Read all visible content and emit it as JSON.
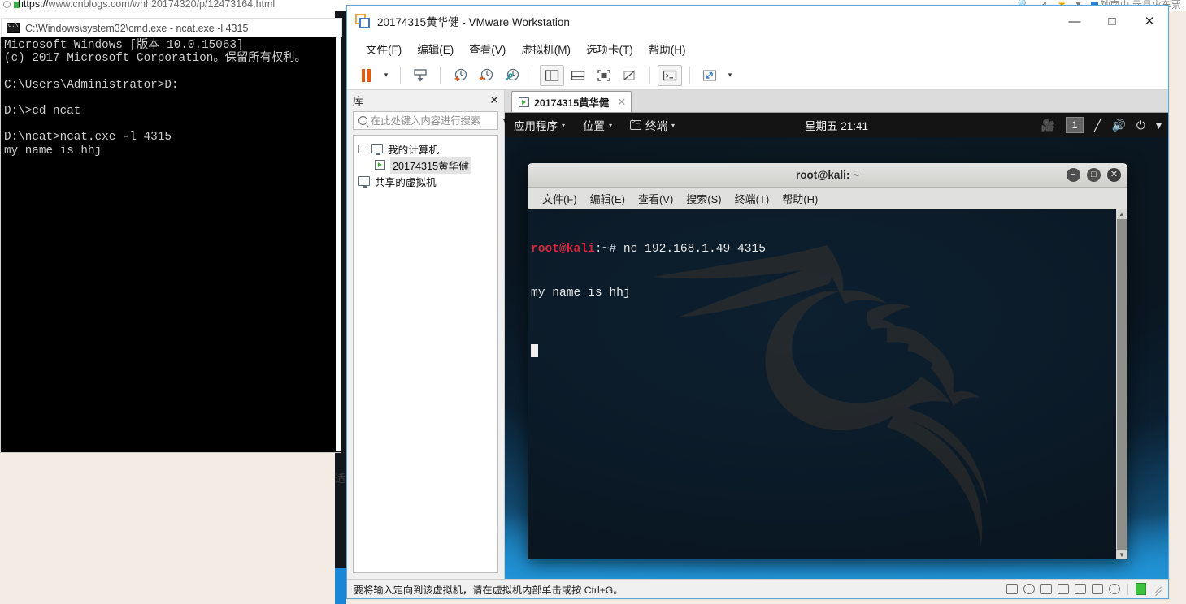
{
  "browser": {
    "url_protocol": "https://",
    "url": "www.cnblogs.com/whh20174320/p/12473164.html",
    "right_items": [
      "search-icon",
      "share-icon",
      "star-icon",
      "chevron-down-icon"
    ],
    "right_text": "钟南山 元旦火车票"
  },
  "cmd": {
    "title": "C:\\Windows\\system32\\cmd.exe - ncat.exe  -l 4315",
    "icon": "cmd-icon",
    "lines": [
      "Microsoft Windows [版本 10.0.15063]",
      "(c) 2017 Microsoft Corporation。保留所有权利。",
      "",
      "C:\\Users\\Administrator>D:",
      "",
      "D:\\>cd ncat",
      "",
      "D:\\ncat>ncat.exe -l 4315",
      "my name is hhj"
    ]
  },
  "vmware": {
    "title": "20174315黄华健 - VMware Workstation",
    "window_controls": {
      "minimize": "—",
      "maximize": "□",
      "close": "✕"
    },
    "menu": [
      {
        "label": "文件(F)",
        "name": "menu-file"
      },
      {
        "label": "编辑(E)",
        "name": "menu-edit"
      },
      {
        "label": "查看(V)",
        "name": "menu-view"
      },
      {
        "label": "虚拟机(M)",
        "name": "menu-vm"
      },
      {
        "label": "选项卡(T)",
        "name": "menu-tabs"
      },
      {
        "label": "帮助(H)",
        "name": "menu-help"
      }
    ],
    "toolbar": [
      {
        "name": "pause-button",
        "icon": "pause-icon"
      },
      {
        "name": "power-dropdown",
        "icon": "chevron-down-icon"
      },
      {
        "name": "send-ctrl-alt-del-button",
        "icon": "keyboard-send-icon"
      },
      {
        "name": "take-snapshot-button",
        "icon": "snapshot-add-icon"
      },
      {
        "name": "revert-snapshot-button",
        "icon": "snapshot-revert-icon"
      },
      {
        "name": "snapshot-manager-button",
        "icon": "snapshot-manager-icon"
      },
      {
        "name": "show-library-button",
        "icon": "panel-left-icon"
      },
      {
        "name": "show-thumbnail-bar-button",
        "icon": "panel-bottom-icon"
      },
      {
        "name": "full-screen-button",
        "icon": "fullscreen-icon"
      },
      {
        "name": "unity-mode-button",
        "icon": "unity-icon"
      },
      {
        "name": "console-view-button",
        "icon": "console-icon"
      },
      {
        "name": "stretch-guest-button",
        "icon": "stretch-icon"
      },
      {
        "name": "stretch-dropdown",
        "icon": "chevron-down-icon"
      }
    ],
    "library": {
      "title": "库",
      "close_icon": "close-icon",
      "search_placeholder": "在此处键入内容进行搜索",
      "search_value": "",
      "tree": [
        {
          "label": "我的计算机",
          "icon": "monitor-icon",
          "expandable": true,
          "selected": false
        },
        {
          "label": "20174315黄华健",
          "icon": "vm-icon",
          "expandable": false,
          "selected": true
        },
        {
          "label": "共享的虚拟机",
          "icon": "shared-vm-icon",
          "expandable": false,
          "selected": false
        }
      ]
    },
    "tab": {
      "label": "20174315黄华健",
      "icon": "vm-icon",
      "close_icon": "close-icon"
    },
    "status": {
      "text": "要将输入定向到该虚拟机，请在虚拟机内部单击或按 Ctrl+G。",
      "icons": [
        "hard-disk-icon",
        "cd-dvd-icon",
        "network-icon",
        "printer-icon",
        "sound-icon",
        "usb-icon",
        "display-icon",
        "message-icon",
        "resize-grip-icon"
      ]
    }
  },
  "kali": {
    "panel": {
      "applications": "应用程序",
      "places": "位置",
      "terminal": "终端",
      "clock": "星期五 21:41",
      "workspace": "1",
      "right_icons": [
        "screencast-icon",
        "workspace-indicator",
        "network-icon",
        "volume-icon",
        "power-icon",
        "chevron-down-icon"
      ]
    },
    "terminal": {
      "title": "root@kali: ~",
      "window_buttons": {
        "minimize": "−",
        "maximize": "□",
        "close": "✕"
      },
      "menu": [
        "文件(F)",
        "编辑(E)",
        "查看(V)",
        "搜索(S)",
        "终端(T)",
        "帮助(H)"
      ],
      "prompt_user": "root@kali",
      "prompt_path": ":~# ",
      "command": "nc 192.168.1.49 4315",
      "output": "my name is hhj"
    }
  },
  "colors": {
    "accent_orange": "#e8590c",
    "kali_red": "#d7263d",
    "vmware_blue": "#3b7cc4",
    "vmware_orange": "#f2a93b",
    "desktop_blue": "#1a7ab5"
  }
}
